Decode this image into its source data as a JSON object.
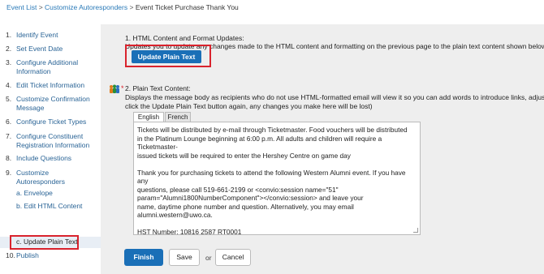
{
  "breadcrumb": {
    "items": [
      "Event List",
      "Customize Autoresponders",
      "Event Ticket Purchase Thank You"
    ],
    "separator": ">"
  },
  "sidebar": {
    "items": [
      {
        "num": "1.",
        "label": "Identify Event"
      },
      {
        "num": "2.",
        "label": "Set Event Date"
      },
      {
        "num": "3.",
        "label": "Configure Additional Information"
      },
      {
        "num": "4.",
        "label": "Edit Ticket Information"
      },
      {
        "num": "5.",
        "label": "Customize Confirmation Message"
      },
      {
        "num": "6.",
        "label": "Configure Ticket Types"
      },
      {
        "num": "7.",
        "label": "Configure Constituent Registration Information"
      },
      {
        "num": "8.",
        "label": "Include Questions"
      },
      {
        "num": "9.",
        "label": "Customize Autoresponders"
      },
      {
        "num": "10.",
        "label": "Publish"
      }
    ],
    "subitems": [
      {
        "label": "a. Envelope"
      },
      {
        "label": "b. Edit HTML Content"
      },
      {
        "label": "c. Update Plain Text"
      }
    ]
  },
  "section1": {
    "title": "1. HTML Content and Format Updates:",
    "desc": "Updates you to update any changes made to the HTML content and formatting on the previous page to the plain text content shown below",
    "button": "Update Plain Text"
  },
  "section2": {
    "required": "*",
    "title": "2. Plain Text Content:",
    "desc_line1": "Displays the message body as recipients who do not use HTML-formatted email will view it so you can add words to introduce links, adjust",
    "desc_line2": "click the Update Plain Text button again, any changes you make here will be lost)",
    "tabs": [
      "English",
      "French"
    ]
  },
  "content": {
    "p1": "Tickets will be distributed by e-mail through Ticketmaster. Food vouchers will be distributed\nin the Platinum Lounge beginning at 6:00 p.m. All adults and children will require a Ticketmaster-\nissued tickets will be required to enter the Hershey Centre on game day",
    "p2": "Thank you for purchasing tickets to attend the following Western Alumni event. If you have any\nquestions, please call 519-661-2199 or <convio:session name=\"51\"\nparam=\"Alumni1800NumberComponent\"></convio:session> and leave your\nname, daytime phone number and question. Alternatively, you may email\nalumni.western@uwo.ca.",
    "p3": "HST Number: 10816 2587 RT0001"
  },
  "actions": {
    "finish": "Finish",
    "save": "Save",
    "or": "or",
    "cancel": "Cancel"
  },
  "colors": {
    "primary": "#1a6fb7",
    "highlight_border": "#d9232d",
    "link": "#2a6496"
  }
}
